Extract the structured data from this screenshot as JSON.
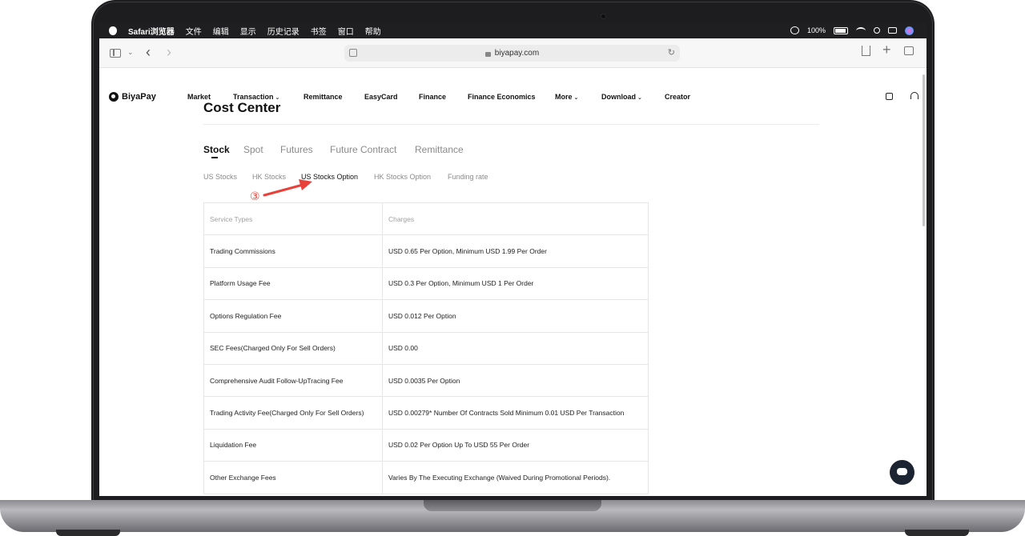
{
  "menubar": {
    "items": [
      "Safari浏览器",
      "文件",
      "编辑",
      "显示",
      "历史记录",
      "书签",
      "窗口",
      "帮助"
    ],
    "battery_text": "100%"
  },
  "browser": {
    "url": "biyapay.com"
  },
  "site": {
    "logo": "BiyaPay",
    "nav": [
      {
        "label": "Market"
      },
      {
        "label": "Transaction",
        "caret": "⌄"
      },
      {
        "label": "Remittance"
      },
      {
        "label": "EasyCard"
      },
      {
        "label": "Finance"
      },
      {
        "label": "Finance Economics"
      },
      {
        "label": "More",
        "caret": "⌄"
      },
      {
        "label": "Download",
        "caret": "⌄"
      },
      {
        "label": "Creator"
      }
    ]
  },
  "page": {
    "title": "Cost Center",
    "main_tabs": [
      "Stock",
      "Spot",
      "Futures",
      "Future Contract",
      "Remittance"
    ],
    "active_main_tab": "Stock",
    "sub_tabs": [
      "US Stocks",
      "HK Stocks",
      "US Stocks Option",
      "HK Stocks Option",
      "Funding rate"
    ],
    "active_sub_tab": "US Stocks Option",
    "annotation": "③"
  },
  "table": {
    "headers": [
      "Service Types",
      "Charges"
    ],
    "rows": [
      [
        "Trading Commissions",
        "USD 0.65 Per Option, Minimum USD 1.99 Per Order"
      ],
      [
        "Platform Usage Fee",
        "USD 0.3 Per Option, Minimum USD 1 Per Order"
      ],
      [
        "Options Regulation Fee",
        "USD 0.012 Per Option"
      ],
      [
        "SEC Fees(Charged Only For Sell Orders)",
        "USD 0.00"
      ],
      [
        "Comprehensive Audit Follow-UpTracing Fee",
        "USD 0.0035 Per Option"
      ],
      [
        "Trading Activity Fee(Charged Only For Sell Orders)",
        "USD 0.00279* Number Of Contracts Sold Minimum 0.01 USD Per Transaction"
      ],
      [
        "Liquidation Fee",
        "USD 0.02 Per Option Up To USD 55 Per Order"
      ],
      [
        "Other Exchange Fees",
        "Varies By The Executing Exchange (Waived During Promotional Periods)."
      ]
    ]
  },
  "colors": {
    "annotation": "#e8413a",
    "menubar": "#1f1f21",
    "fab": "#1c2331"
  }
}
